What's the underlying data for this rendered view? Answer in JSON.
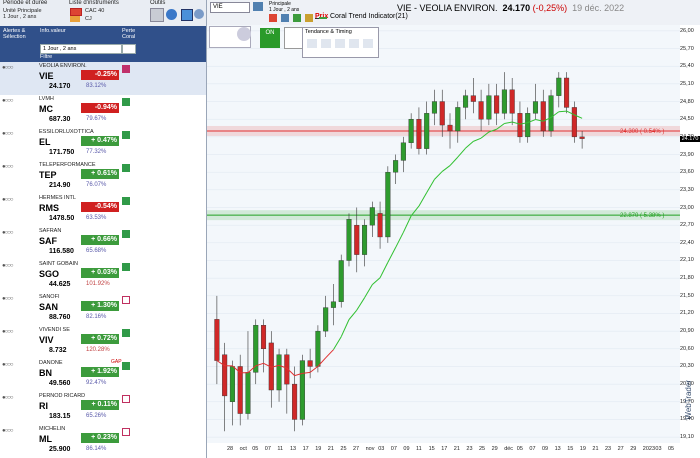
{
  "toolbar_left": {
    "period_label": "Période et durée",
    "period_value": "Unité Principale\n1 Jour , 2 ans",
    "list_label": "Liste d'instruments",
    "list_value": "CAC 40",
    "list_sub": "CJ",
    "tools_label": "Outils"
  },
  "header": {
    "alerts_label": "Alertes & Sélection",
    "info_label": "Info.valeur",
    "perte_label": "Perte Coral",
    "period_sel": "1 Jour , 2 ans",
    "filter_label": "Filtre"
  },
  "rows": [
    {
      "name": "VEOLIA ENVIRON.",
      "ticker": "VIE",
      "price": "24.170",
      "change": "-0.25%",
      "dir": "dn",
      "pct": "83.12%",
      "flag": "red",
      "active": true
    },
    {
      "name": "LVMH",
      "ticker": "MC",
      "price": "687.30",
      "change": "-0.94%",
      "dir": "dn",
      "pct": "79.67%",
      "flag": "green"
    },
    {
      "name": "ESSILORLUXOTTICA",
      "ticker": "EL",
      "price": "171.750",
      "change": "+ 0.47%",
      "dir": "up",
      "pct": "77.32%",
      "flag": "green"
    },
    {
      "name": "TELEPERFORMANCE",
      "ticker": "TEP",
      "price": "214.90",
      "change": "+ 0.61%",
      "dir": "up",
      "pct": "76.07%",
      "flag": "green"
    },
    {
      "name": "HERMES INTL",
      "ticker": "RMS",
      "price": "1478.50",
      "change": "-0.54%",
      "dir": "dn",
      "pct": "63.53%",
      "flag": "green"
    },
    {
      "name": "SAFRAN",
      "ticker": "SAF",
      "price": "116.580",
      "change": "+ 0.66%",
      "dir": "up",
      "pct": "65.68%",
      "flag": "green"
    },
    {
      "name": "SAINT GOBAIN",
      "ticker": "SGO",
      "price": "44.625",
      "change": "+ 0.03%",
      "dir": "up",
      "pct": "101.92%",
      "flag": "green",
      "hi": true
    },
    {
      "name": "SANOFI",
      "ticker": "SAN",
      "price": "88.760",
      "change": "+ 1.30%",
      "dir": "up",
      "pct": "82.16%",
      "flag": "border"
    },
    {
      "name": "VIVENDI SE",
      "ticker": "VIV",
      "price": "8.732",
      "change": "+ 0.72%",
      "dir": "up",
      "pct": "120.28%",
      "flag": "green",
      "hi": true
    },
    {
      "name": "DANONE",
      "ticker": "BN",
      "price": "49.560",
      "change": "+ 1.92%",
      "dir": "up",
      "pct": "92.47%",
      "flag": "green",
      "extra": "GAP"
    },
    {
      "name": "PERNOD RICARD",
      "ticker": "RI",
      "price": "183.15",
      "change": "+ 0.11%",
      "dir": "up",
      "pct": "65.26%",
      "flag": "border"
    },
    {
      "name": "MICHELIN",
      "ticker": "ML",
      "price": "25.900",
      "change": "+ 0.23%",
      "dir": "up",
      "pct": "86.14%",
      "flag": "border"
    }
  ],
  "chart_toolbar": {
    "symbol": "VIE",
    "unit_label": "Principale",
    "unit_value": "1 Jour , 2 ans",
    "price_btn": "Prix",
    "indicator": "Coral Trend Indicator(21)",
    "panel_title": "Tendance & Timing",
    "on_label": "ON"
  },
  "chart": {
    "title": "VIE - VEOLIA ENVIRON.",
    "last": "24.170",
    "change": "(-0,25%)",
    "date": "19 déc. 2022",
    "level_high": "24.300 ( 0.54% )",
    "level_low": "22.870 ( 5.38% )",
    "last_tag": "24.170",
    "watermark": "WebTrader"
  },
  "chart_data": {
    "type": "candlestick",
    "ylim": [
      19.0,
      26.1
    ],
    "yticks": [
      "26,00",
      "25,70",
      "25,40",
      "25,10",
      "24,80",
      "24,50",
      "24,20",
      "23,90",
      "23,60",
      "23,30",
      "23,00",
      "22,70",
      "22,40",
      "22,10",
      "21,80",
      "21,50",
      "21,20",
      "20,90",
      "20,60",
      "20,30",
      "20,00",
      "19,70",
      "19,40",
      "19,10"
    ],
    "xticks": [
      "28",
      "oct",
      "05",
      "07",
      "11",
      "13",
      "17",
      "19",
      "21",
      "25",
      "27",
      "nov",
      "03",
      "07",
      "09",
      "11",
      "15",
      "17",
      "21",
      "23",
      "25",
      "29",
      "déc",
      "05",
      "07",
      "09",
      "13",
      "15",
      "19",
      "21",
      "23",
      "27",
      "29",
      "2023",
      "03",
      "05"
    ],
    "candles": [
      [
        21.1,
        20.4,
        21.5,
        20.0
      ],
      [
        20.5,
        19.8,
        20.7,
        19.2
      ],
      [
        19.7,
        20.3,
        20.4,
        19.3
      ],
      [
        20.3,
        19.5,
        20.5,
        19.3
      ],
      [
        19.5,
        20.2,
        20.9,
        19.4
      ],
      [
        20.2,
        21.0,
        21.1,
        20.0
      ],
      [
        21.0,
        20.6,
        21.1,
        20.2
      ],
      [
        20.7,
        19.9,
        20.9,
        19.6
      ],
      [
        19.9,
        20.5,
        20.6,
        19.7
      ],
      [
        20.5,
        20.0,
        20.6,
        19.5
      ],
      [
        20.0,
        19.4,
        20.3,
        19.2
      ],
      [
        19.4,
        20.4,
        20.5,
        19.3
      ],
      [
        20.4,
        20.3,
        20.6,
        20.1
      ],
      [
        20.3,
        20.9,
        21.0,
        20.2
      ],
      [
        20.9,
        21.3,
        21.5,
        20.8
      ],
      [
        21.3,
        21.4,
        21.7,
        21.0
      ],
      [
        21.4,
        22.1,
        22.2,
        21.3
      ],
      [
        22.1,
        22.8,
        22.9,
        22.0
      ],
      [
        22.7,
        22.2,
        23.0,
        21.9
      ],
      [
        22.2,
        22.7,
        22.8,
        22.0
      ],
      [
        22.7,
        23.0,
        23.1,
        22.5
      ],
      [
        22.9,
        22.5,
        23.1,
        22.3
      ],
      [
        22.5,
        23.6,
        23.7,
        22.4
      ],
      [
        23.6,
        23.8,
        23.9,
        23.4
      ],
      [
        23.8,
        24.1,
        24.2,
        23.6
      ],
      [
        24.1,
        24.5,
        24.6,
        24.0
      ],
      [
        24.5,
        24.0,
        24.7,
        23.9
      ],
      [
        24.0,
        24.6,
        24.8,
        23.9
      ],
      [
        24.6,
        24.8,
        25.0,
        24.4
      ],
      [
        24.8,
        24.4,
        25.0,
        24.2
      ],
      [
        24.4,
        24.3,
        24.6,
        24.0
      ],
      [
        24.3,
        24.7,
        24.8,
        24.1
      ],
      [
        24.7,
        24.9,
        25.0,
        24.5
      ],
      [
        24.9,
        24.8,
        25.2,
        24.6
      ],
      [
        24.8,
        24.5,
        25.0,
        24.3
      ],
      [
        24.5,
        24.9,
        25.1,
        24.4
      ],
      [
        24.9,
        24.6,
        25.1,
        24.4
      ],
      [
        24.6,
        25.0,
        25.3,
        24.5
      ],
      [
        25.0,
        24.6,
        25.2,
        24.4
      ],
      [
        24.6,
        24.2,
        24.8,
        24.1
      ],
      [
        24.2,
        24.6,
        24.7,
        24.1
      ],
      [
        24.6,
        24.8,
        25.1,
        24.5
      ],
      [
        24.8,
        24.3,
        25.0,
        24.2
      ],
      [
        24.3,
        24.9,
        25.0,
        24.2
      ],
      [
        24.9,
        25.2,
        25.3,
        24.7
      ],
      [
        25.2,
        24.7,
        25.3,
        24.6
      ],
      [
        24.7,
        24.2,
        24.8,
        24.1
      ],
      [
        24.2,
        24.17,
        24.3,
        24.0
      ]
    ]
  }
}
